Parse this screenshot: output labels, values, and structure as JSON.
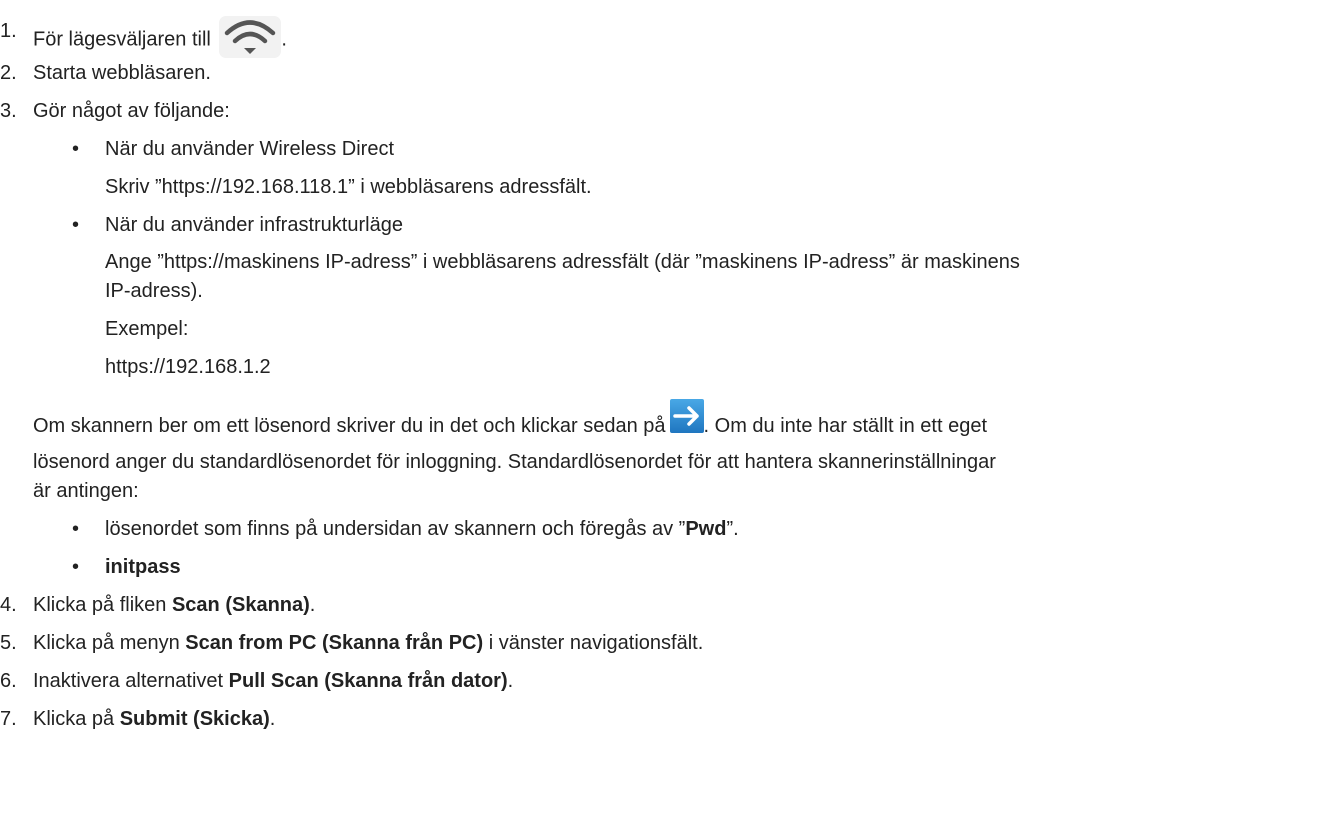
{
  "steps": [
    {
      "num": "1.",
      "text": "För lägesväljaren till",
      "suffix": "."
    },
    {
      "num": "2.",
      "text": "Starta webbläsaren."
    },
    {
      "num": "3.",
      "text": "Gör något av följande:"
    },
    {
      "num": "4.",
      "pre": "Klicka på fliken ",
      "bold": "Scan (Skanna)",
      "post": "."
    },
    {
      "num": "5.",
      "pre": "Klicka på menyn ",
      "bold": "Scan from PC (Skanna från PC)",
      "post": " i vänster navigationsfält."
    },
    {
      "num": "6.",
      "pre": "Inaktivera alternativet ",
      "bold": "Pull Scan (Skanna från dator)",
      "post": "."
    },
    {
      "num": "7.",
      "pre": "Klicka på ",
      "bold": "Submit (Skicka)",
      "post": "."
    }
  ],
  "step3_options": [
    {
      "bullet": "•",
      "title": "När du använder Wireless Direct",
      "lines": [
        "Skriv ”https://192.168.118.1” i webbläsarens adressfält."
      ]
    },
    {
      "bullet": "•",
      "title": "När du använder infrastrukturläge",
      "lines": [
        "Ange ”https://maskinens IP-adress” i webbläsarens adressfält (där ”maskinens IP-adress” är maskinens",
        "IP-adress).",
        "Exempel:",
        "https://192.168.1.2"
      ]
    }
  ],
  "password_note": {
    "line1_pre": "Om skannern ber om ett lösenord skriver du in det och klickar sedan på",
    "line1_post": ". Om du inte har ställt in ett eget",
    "line2": "lösenord anger du standardlösenordet för inloggning. Standardlösenordet för att hantera skannerinställningar",
    "line3": "är antingen:"
  },
  "password_options": [
    {
      "bullet": "•",
      "pre": "lösenordet som finns på undersidan av skannern och föregås av ”",
      "bold": "Pwd",
      "post": "”."
    },
    {
      "bullet": "•",
      "bold": "initpass"
    }
  ],
  "icons": {
    "wifi": "wifi-icon",
    "go": "arrow-right-icon",
    "wifi_color": "#555555",
    "go_color": "#2b86d2"
  }
}
